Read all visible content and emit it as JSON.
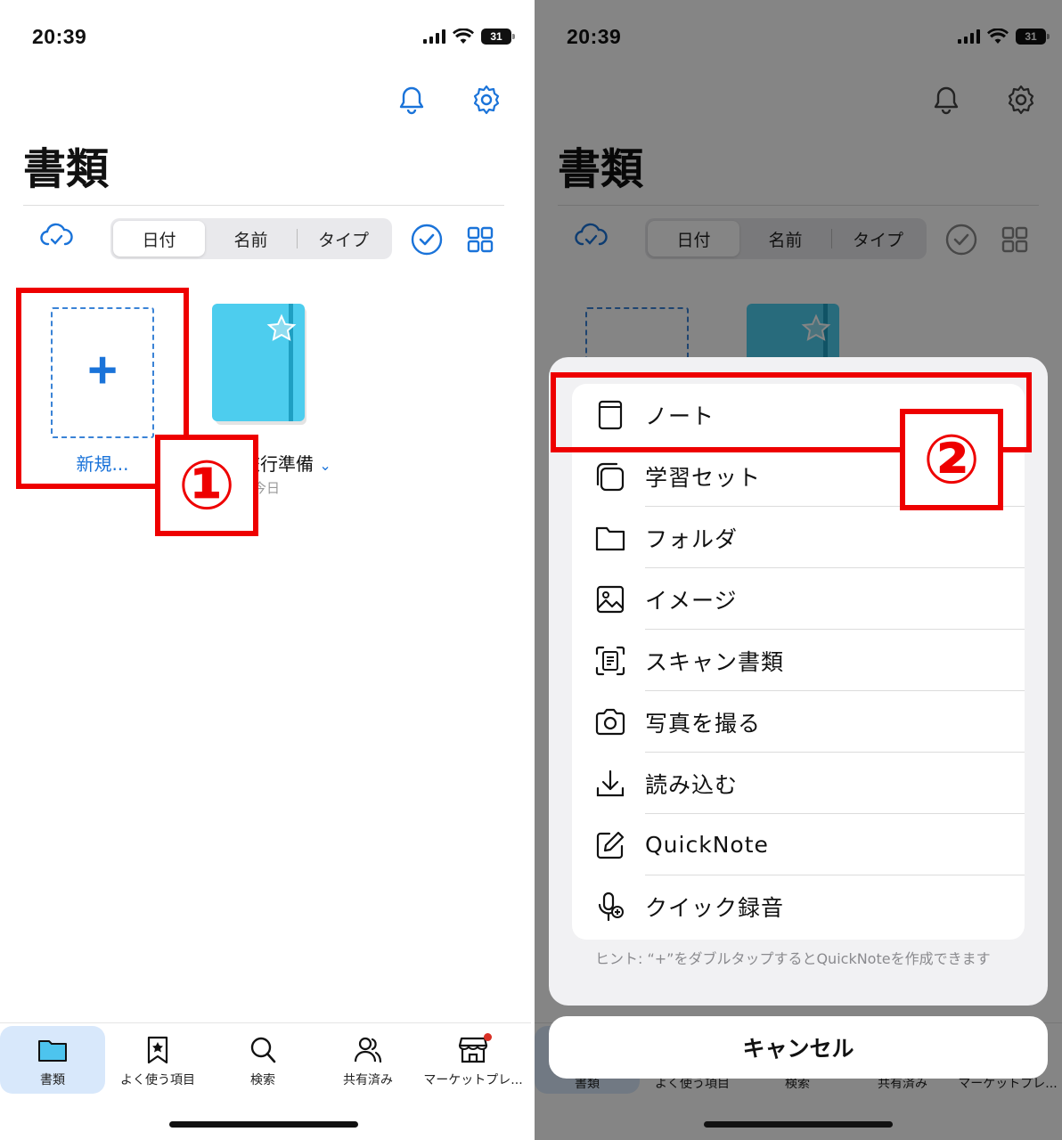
{
  "status_bar": {
    "time": "20:39",
    "battery": "31"
  },
  "header": {
    "title": "書類",
    "icons": [
      "bell-icon",
      "gear-icon"
    ]
  },
  "toolbar": {
    "sort_options": [
      "日付",
      "名前",
      "タイプ"
    ],
    "selected_sort": "日付"
  },
  "documents": {
    "new_label": "新規...",
    "items": [
      {
        "name": "旅行準備",
        "date": "今日",
        "cover_color": "#4dcdee"
      }
    ]
  },
  "tabbar": {
    "tabs": [
      {
        "label": "書類",
        "icon": "folder-icon",
        "active": true
      },
      {
        "label": "よく使う項目",
        "icon": "bookmark-star-icon",
        "active": false
      },
      {
        "label": "検索",
        "icon": "search-icon",
        "active": false
      },
      {
        "label": "共有済み",
        "icon": "people-icon",
        "active": false
      },
      {
        "label": "マーケットプレ...",
        "icon": "store-icon",
        "active": false
      }
    ]
  },
  "annotations": {
    "step1": "①",
    "step2": "②"
  },
  "sheet": {
    "items": [
      {
        "label": "ノート",
        "icon": "notebook-icon"
      },
      {
        "label": "学習セット",
        "icon": "cards-icon"
      },
      {
        "label": "フォルダ",
        "icon": "folder-icon"
      },
      {
        "label": "イメージ",
        "icon": "image-icon"
      },
      {
        "label": "スキャン書類",
        "icon": "scan-icon"
      },
      {
        "label": "写真を撮る",
        "icon": "camera-icon"
      },
      {
        "label": "読み込む",
        "icon": "download-icon"
      },
      {
        "label": "QuickNote",
        "icon": "edit-icon"
      },
      {
        "label": "クイック録音",
        "icon": "mic-icon"
      }
    ],
    "hint": "ヒント: “+”をダブルタップするとQuickNoteを作成できます",
    "cancel": "キャンセル"
  },
  "colors": {
    "accent": "#1a73d9",
    "annotation": "#ee0000",
    "notebook": "#4dcdee"
  }
}
